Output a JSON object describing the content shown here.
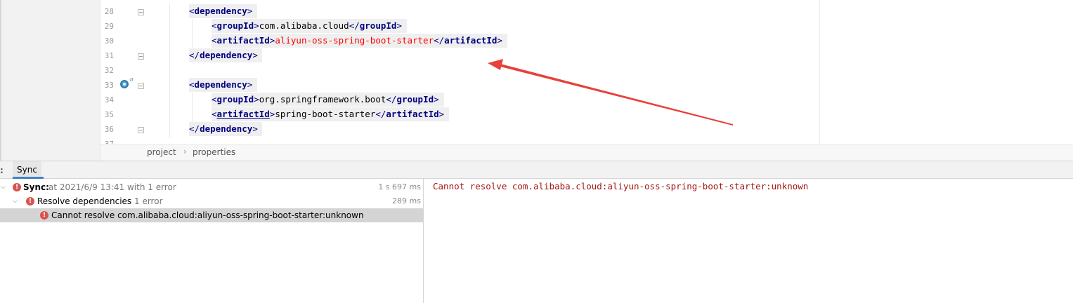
{
  "editor": {
    "lines": [
      {
        "num": "28",
        "indent": 1,
        "tokens": [
          {
            "t": "<",
            "c": "tag-bracket"
          },
          {
            "t": "dependency",
            "c": "tag-name"
          },
          {
            "t": ">",
            "c": "tag-bracket"
          }
        ]
      },
      {
        "num": "29",
        "indent": 2,
        "tokens": [
          {
            "t": "<",
            "c": "tag-bracket"
          },
          {
            "t": "groupId",
            "c": "tag-name"
          },
          {
            "t": ">",
            "c": "tag-bracket"
          },
          {
            "t": "com.alibaba.cloud",
            "c": "text-val"
          },
          {
            "t": "</",
            "c": "tag-bracket"
          },
          {
            "t": "groupId",
            "c": "tag-name"
          },
          {
            "t": ">",
            "c": "tag-bracket"
          }
        ]
      },
      {
        "num": "30",
        "indent": 2,
        "tokens": [
          {
            "t": "<",
            "c": "tag-bracket"
          },
          {
            "t": "artifactId",
            "c": "tag-name"
          },
          {
            "t": ">",
            "c": "tag-bracket"
          },
          {
            "t": "aliyun-oss-spring-boot-starter",
            "c": "text-err"
          },
          {
            "t": "</",
            "c": "tag-bracket"
          },
          {
            "t": "artifactId",
            "c": "tag-name"
          },
          {
            "t": ">",
            "c": "tag-bracket"
          }
        ]
      },
      {
        "num": "31",
        "indent": 1,
        "tokens": [
          {
            "t": "</",
            "c": "tag-bracket"
          },
          {
            "t": "dependency",
            "c": "tag-name"
          },
          {
            "t": ">",
            "c": "tag-bracket"
          }
        ]
      },
      {
        "num": "32",
        "indent": 0,
        "tokens": []
      },
      {
        "num": "33",
        "indent": 1,
        "tokens": [
          {
            "t": "<",
            "c": "tag-bracket"
          },
          {
            "t": "dependency",
            "c": "tag-name"
          },
          {
            "t": ">",
            "c": "tag-bracket"
          }
        ]
      },
      {
        "num": "34",
        "indent": 2,
        "tokens": [
          {
            "t": "<",
            "c": "tag-bracket"
          },
          {
            "t": "groupId",
            "c": "tag-name"
          },
          {
            "t": ">",
            "c": "tag-bracket"
          },
          {
            "t": "org.springframework.boot",
            "c": "text-val"
          },
          {
            "t": "</",
            "c": "tag-bracket"
          },
          {
            "t": "groupId",
            "c": "tag-name"
          },
          {
            "t": ">",
            "c": "tag-bracket"
          }
        ]
      },
      {
        "num": "35",
        "indent": 2,
        "tokens": [
          {
            "t": "<",
            "c": "tag-bracket"
          },
          {
            "t": "artifactId",
            "c": "tag-name link"
          },
          {
            "t": ">",
            "c": "tag-bracket"
          },
          {
            "t": "spring-boot-starter",
            "c": "text-val"
          },
          {
            "t": "</",
            "c": "tag-bracket"
          },
          {
            "t": "artifactId",
            "c": "tag-name"
          },
          {
            "t": ">",
            "c": "tag-bracket"
          }
        ]
      },
      {
        "num": "36",
        "indent": 1,
        "tokens": [
          {
            "t": "</",
            "c": "tag-bracket"
          },
          {
            "t": "dependency",
            "c": "tag-name"
          },
          {
            "t": ">",
            "c": "tag-bracket"
          }
        ]
      },
      {
        "num": "37",
        "indent": 0,
        "tokens": []
      }
    ],
    "gutter_icon": "maven-sync-icon"
  },
  "breadcrumb": {
    "items": [
      "project",
      "properties"
    ],
    "separator": "›"
  },
  "build": {
    "header_prefix": ":",
    "tab_label": "Sync",
    "tree": {
      "root": {
        "label": "Sync:",
        "detail": "at 2021/6/9 13:41 with 1 error",
        "time": "1 s 697 ms",
        "icon": "error-icon"
      },
      "child": {
        "label": "Resolve dependencies",
        "detail": "1 error",
        "time": "289 ms",
        "icon": "error-icon"
      },
      "leaf": {
        "label": "Cannot resolve com.alibaba.cloud:aliyun-oss-spring-boot-starter:unknown",
        "icon": "error-icon"
      }
    },
    "detail_message": "Cannot resolve com.alibaba.cloud:aliyun-oss-spring-boot-starter:unknown"
  },
  "annotation": {
    "color": "#e8403a",
    "icon": "red-arrow"
  }
}
